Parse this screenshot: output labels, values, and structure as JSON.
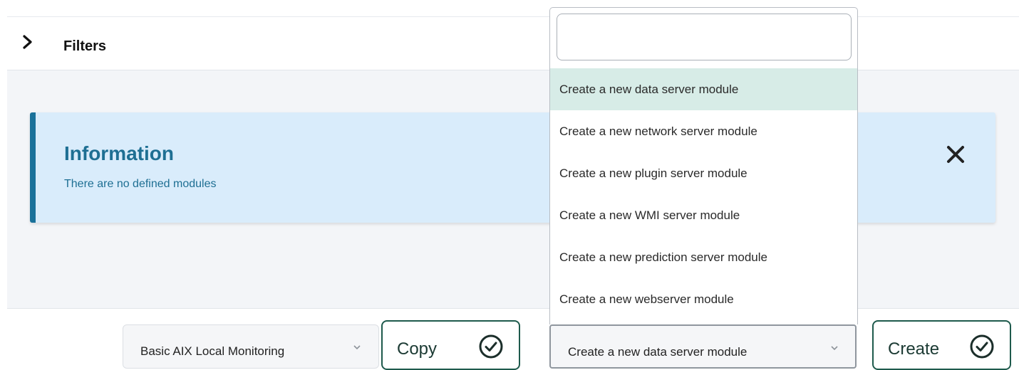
{
  "filters": {
    "title": "Filters",
    "icon": "chevron-right-icon"
  },
  "info": {
    "title": "Information",
    "message": "There are no defined modules",
    "close_icon": "close-icon"
  },
  "template_select": {
    "value": "Basic AIX Local Monitoring",
    "icon": "chevron-down-icon"
  },
  "copy_button": {
    "label": "Copy",
    "icon": "check-circle-icon"
  },
  "module_select": {
    "value": "Create a new data server module",
    "icon": "chevron-down-icon"
  },
  "create_button": {
    "label": "Create",
    "icon": "check-circle-icon"
  },
  "dropdown": {
    "search_value": "",
    "items": [
      {
        "label": "Create a new data server module",
        "selected": true
      },
      {
        "label": "Create a new network server module"
      },
      {
        "label": "Create a new plugin server module"
      },
      {
        "label": "Create a new WMI server module"
      },
      {
        "label": "Create a new prediction server module"
      },
      {
        "label": "Create a new webserver module"
      }
    ]
  },
  "colors": {
    "accent": "#19719a",
    "info_bg": "#d9ecfb",
    "button_border": "#1e5a4c",
    "selected_item_bg": "#d7ece7"
  }
}
